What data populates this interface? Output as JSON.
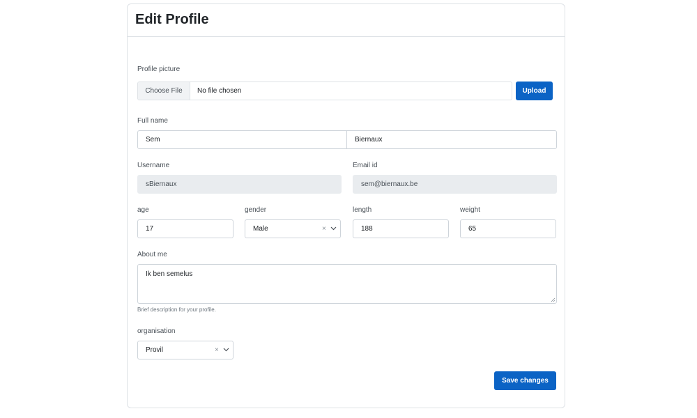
{
  "page": {
    "title": "Edit Profile"
  },
  "profile_picture": {
    "label": "Profile picture",
    "choose_file": "Choose File",
    "file_status": "No file chosen",
    "upload_button": "Upload"
  },
  "full_name": {
    "label": "Full name",
    "first": "Sem",
    "last": "Biernaux"
  },
  "username": {
    "label": "Username",
    "value": "sBiernaux"
  },
  "email": {
    "label": "Email id",
    "value": "sem@biernaux.be"
  },
  "age": {
    "label": "age",
    "value": "17"
  },
  "gender": {
    "label": "gender",
    "value": "Male",
    "clear": "×"
  },
  "length": {
    "label": "length",
    "value": "188"
  },
  "weight": {
    "label": "weight",
    "value": "65"
  },
  "about": {
    "label": "About me",
    "value": "Ik ben semelus",
    "help": "Brief description for your profile."
  },
  "organisation": {
    "label": "organisation",
    "value": "Provil",
    "clear": "×"
  },
  "actions": {
    "save": "Save changes"
  },
  "colors": {
    "primary": "#0b63c5",
    "border": "#dee2e6",
    "readonly_bg": "#e9ecef"
  }
}
